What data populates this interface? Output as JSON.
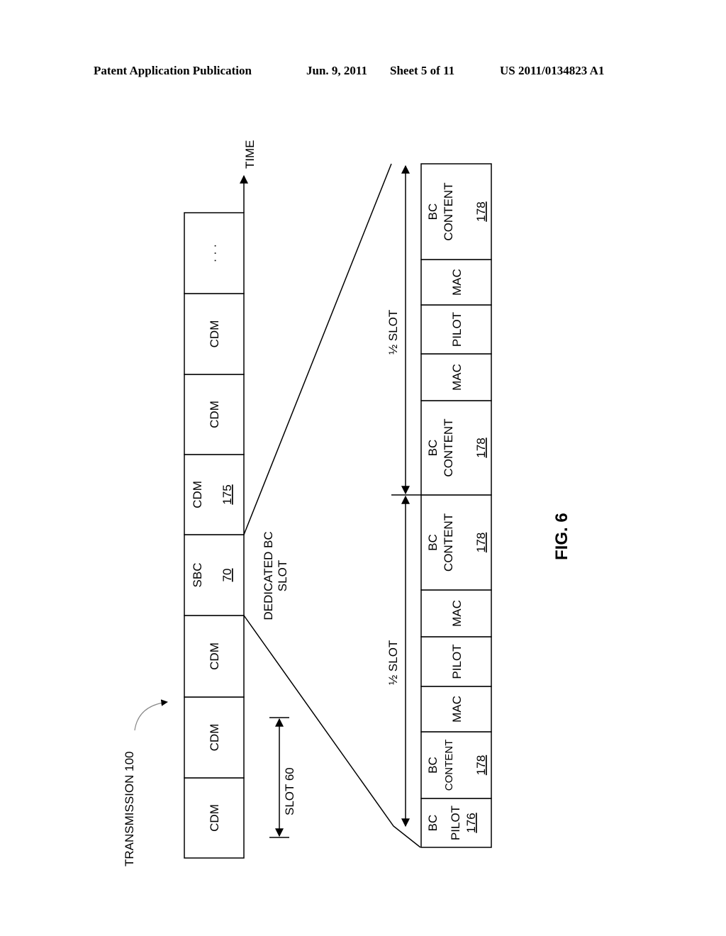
{
  "header": {
    "publication": "Patent Application Publication",
    "date": "Jun. 9, 2011",
    "sheet": "Sheet 5 of 11",
    "number": "US 2011/0134823 A1"
  },
  "figure": {
    "label": "FIG. 6",
    "transmission_label": "TRANSMISSION 100",
    "time_label": "TIME",
    "slot_label": "SLOT 60",
    "dedicated_label_line1": "DEDICATED BC",
    "dedicated_label_line2": "SLOT",
    "half_slot_label": "½ SLOT",
    "transmission_slots": [
      {
        "label": "CDM",
        "ref": ""
      },
      {
        "label": "CDM",
        "ref": ""
      },
      {
        "label": "CDM",
        "ref": ""
      },
      {
        "label": "SBC",
        "ref": "70"
      },
      {
        "label": "CDM",
        "ref": "175"
      },
      {
        "label": "CDM",
        "ref": ""
      },
      {
        "label": "CDM",
        "ref": ""
      },
      {
        "label": "· · ·",
        "ref": ""
      }
    ],
    "expanded_segments": [
      {
        "line1": "BC",
        "line2": "PILOT",
        "ref": "176"
      },
      {
        "line1": "BC",
        "line2": "CONTENT",
        "ref": "178"
      },
      {
        "line1": "MAC",
        "line2": "",
        "ref": ""
      },
      {
        "line1": "PILOT",
        "line2": "",
        "ref": ""
      },
      {
        "line1": "MAC",
        "line2": "",
        "ref": ""
      },
      {
        "line1": "BC",
        "line2": "CONTENT",
        "ref": "178"
      },
      {
        "line1": "BC",
        "line2": "CONTENT",
        "ref": "178"
      },
      {
        "line1": "MAC",
        "line2": "",
        "ref": ""
      },
      {
        "line1": "PILOT",
        "line2": "",
        "ref": ""
      },
      {
        "line1": "MAC",
        "line2": "",
        "ref": ""
      },
      {
        "line1": "BC",
        "line2": "CONTENT",
        "ref": "178"
      }
    ]
  }
}
